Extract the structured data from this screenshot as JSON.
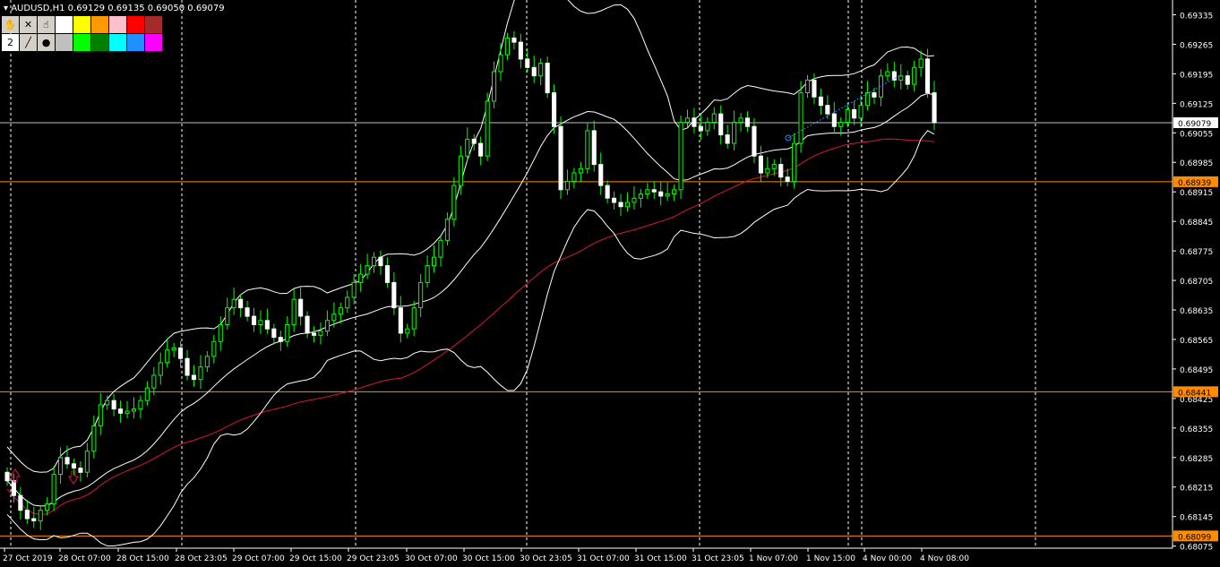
{
  "header": {
    "symbol_line": "AUDUSD,H1  0.69129 0.69135 0.69050 0.69079"
  },
  "toolbar": {
    "row1": [
      {
        "name": "hand-tool-icon",
        "glyph": "✋"
      },
      {
        "name": "delete-icon",
        "glyph": "✕"
      },
      {
        "name": "pointer-icon",
        "glyph": "☝"
      }
    ],
    "row2": [
      {
        "name": "line-width-button",
        "glyph": "2"
      },
      {
        "name": "line-tool-icon",
        "glyph": "╱"
      },
      {
        "name": "dot-tool-icon",
        "glyph": "●"
      }
    ],
    "colors_row1": [
      "#ffffff",
      "#ffff00",
      "#ff9900",
      "#ffc0cb",
      "#ff0000",
      "#a52a2a"
    ],
    "colors_row2": [
      "#c0c0c0",
      "#00ff00",
      "#008000",
      "#00ffff",
      "#1e90ff",
      "#ff00ff"
    ]
  },
  "price_axis": {
    "labels": [
      "0.69335",
      "0.69265",
      "0.69195",
      "0.69125",
      "0.69055",
      "0.68985",
      "0.68915",
      "0.68845",
      "0.68775",
      "0.68705",
      "0.68635",
      "0.68565",
      "0.68495",
      "0.68425",
      "0.68355",
      "0.68285",
      "0.68215",
      "0.68145",
      "0.68075"
    ],
    "current_price": "0.69079",
    "hline_labels": [
      "0.68939",
      "0.68441",
      "0.68099"
    ]
  },
  "time_axis": {
    "labels": [
      "27 Oct 2019",
      "28 Oct 07:00",
      "28 Oct 15:00",
      "28 Oct 23:05",
      "29 Oct 07:00",
      "29 Oct 15:00",
      "29 Oct 23:05",
      "30 Oct 07:00",
      "30 Oct 15:00",
      "30 Oct 23:05",
      "31 Oct 07:00",
      "31 Oct 15:00",
      "31 Oct 23:05",
      "1 Nov 07:00",
      "1 Nov 15:00",
      "4 Nov 00:00",
      "4 Nov 08:00"
    ]
  },
  "colors": {
    "background": "#000000",
    "bull_candle": "#ffffff",
    "bear_candle": "#ffffff",
    "wick": "#00ff00",
    "bollinger": "#ffffff",
    "moving_average": "#dc143c",
    "hline": "#ff8c00",
    "current_line": "#c0c0c0",
    "axis_label_bg": "#ff8c00"
  },
  "chart_data": {
    "type": "candlestick",
    "timeframe": "H1",
    "ylim": [
      0.6807,
      0.6937
    ],
    "closes": [
      0.6823,
      0.68195,
      0.6816,
      0.6814,
      0.68135,
      0.6816,
      0.68175,
      0.68245,
      0.68285,
      0.6827,
      0.6826,
      0.6825,
      0.683,
      0.6836,
      0.6841,
      0.6842,
      0.684,
      0.6839,
      0.68395,
      0.684,
      0.6842,
      0.6845,
      0.6848,
      0.6851,
      0.6854,
      0.68545,
      0.6852,
      0.6848,
      0.6847,
      0.685,
      0.68525,
      0.6856,
      0.686,
      0.6864,
      0.6866,
      0.6864,
      0.6862,
      0.686,
      0.6861,
      0.6859,
      0.6857,
      0.6856,
      0.686,
      0.6866,
      0.6862,
      0.6858,
      0.68575,
      0.68585,
      0.6861,
      0.68625,
      0.6864,
      0.68665,
      0.687,
      0.6872,
      0.6874,
      0.6876,
      0.6874,
      0.687,
      0.6864,
      0.6858,
      0.6859,
      0.6864,
      0.687,
      0.6874,
      0.6876,
      0.688,
      0.6885,
      0.6893,
      0.69,
      0.6904,
      0.6903,
      0.69,
      0.6913,
      0.692,
      0.6924,
      0.6928,
      0.6927,
      0.6923,
      0.6921,
      0.6919,
      0.6922,
      0.6915,
      0.6907,
      0.6892,
      0.6894,
      0.6896,
      0.6897,
      0.6906,
      0.6898,
      0.6893,
      0.689,
      0.6889,
      0.6888,
      0.6889,
      0.689,
      0.6891,
      0.6892,
      0.68915,
      0.68905,
      0.6891,
      0.6892,
      0.6908,
      0.6909,
      0.6907,
      0.6906,
      0.6908,
      0.691,
      0.6905,
      0.6903,
      0.6908,
      0.6909,
      0.6907,
      0.69,
      0.6896,
      0.6897,
      0.6898,
      0.6895,
      0.6894,
      0.6903,
      0.6915,
      0.6918,
      0.6914,
      0.6912,
      0.691,
      0.6907,
      0.6908,
      0.6911,
      0.6909,
      0.6912,
      0.6915,
      0.6914,
      0.6919,
      0.692,
      0.6918,
      0.6919,
      0.6917,
      0.6921,
      0.6923,
      0.6915,
      0.69079
    ]
  }
}
